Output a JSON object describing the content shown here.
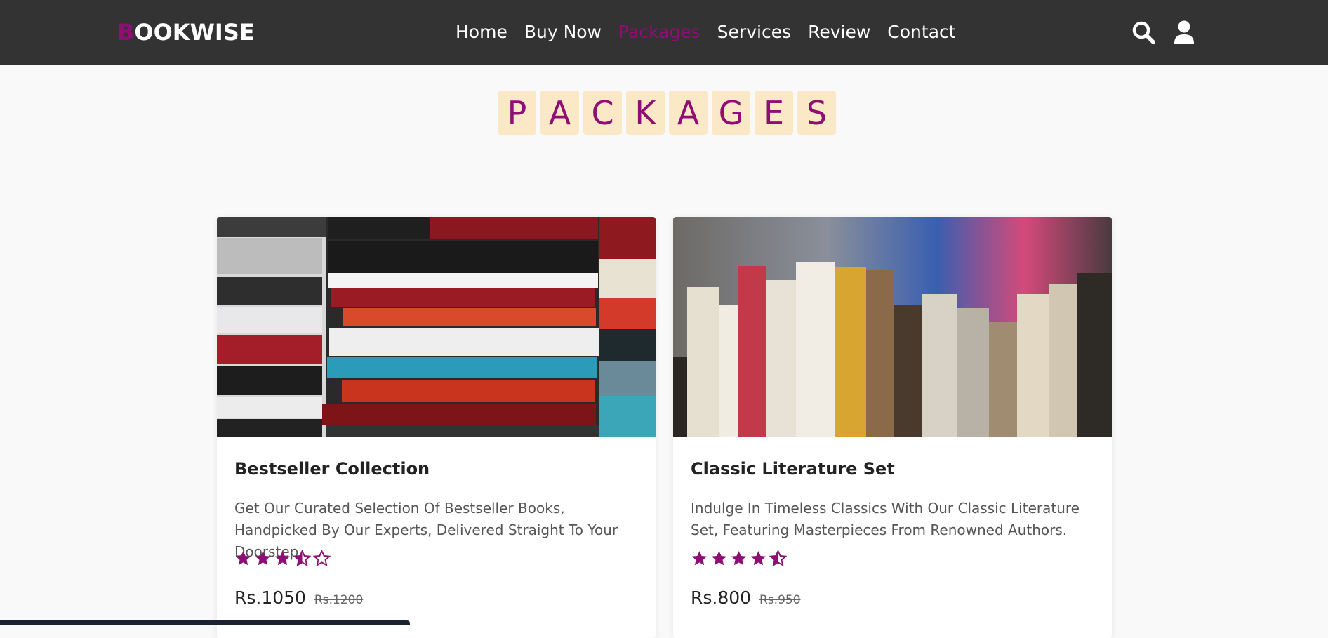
{
  "header": {
    "logo_first": "B",
    "logo_rest": "OOKWISE",
    "nav": [
      {
        "label": "Home",
        "active": false
      },
      {
        "label": "Buy Now",
        "active": false
      },
      {
        "label": "Packages",
        "active": true
      },
      {
        "label": "Services",
        "active": false
      },
      {
        "label": "Review",
        "active": false
      },
      {
        "label": "Contact",
        "active": false
      }
    ],
    "icons": [
      "search-icon",
      "user-icon"
    ]
  },
  "section": {
    "title_letters": [
      "P",
      "A",
      "C",
      "K",
      "A",
      "G",
      "E",
      "S"
    ]
  },
  "cards": [
    {
      "title": "Bestseller Collection",
      "description": "Get Our Curated Selection Of Bestseller Books, Handpicked By Our Experts, Delivered Straight To Your Doorstep.",
      "rating": 3.5,
      "rating_max": 5,
      "price": "Rs.1050",
      "old_price": "Rs.1200"
    },
    {
      "title": "Classic Literature Set",
      "description": "Indulge In Timeless Classics With Our Classic Literature Set, Featuring Masterpieces From Renowned Authors.",
      "rating": 4.5,
      "rating_max": 5,
      "price": "Rs.800",
      "old_price": "Rs.950"
    }
  ],
  "colors": {
    "accent": "#8e0e74",
    "navbar": "#333333",
    "title_tile": "#fbe8c6",
    "background": "#f9f9f9"
  }
}
